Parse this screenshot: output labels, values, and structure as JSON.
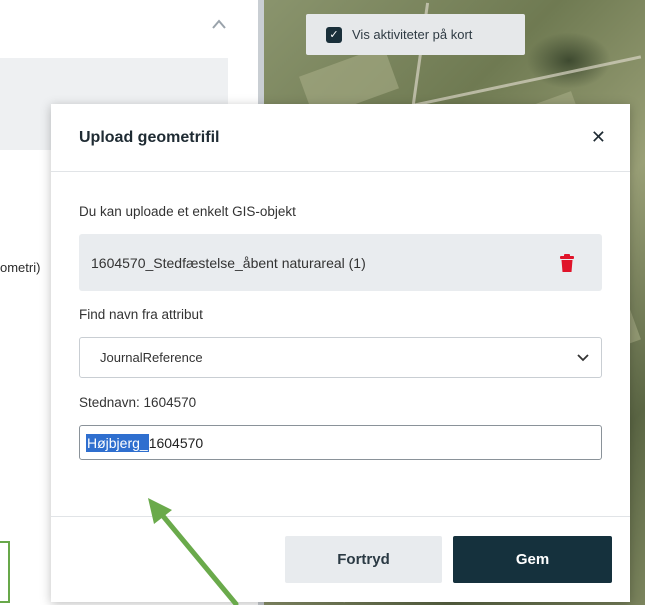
{
  "left_panel": {
    "cut_text": "ometri)"
  },
  "map": {
    "toggle_label": "Vis aktiviteter på kort",
    "checked_glyph": "✓"
  },
  "modal": {
    "title": "Upload geometrifil",
    "close_glyph": "✕",
    "help_text": "Du kan uploade et enkelt GIS-objekt",
    "file_name": "1604570_Stedfæstelse_åbent naturareal (1)",
    "attribute_label": "Find navn fra attribut",
    "attribute_select_value": "JournalReference",
    "stednavn_text": "Stednavn: 1604570",
    "name_input": {
      "selected_part": "Højbjerg_",
      "rest": "1604570"
    },
    "cancel_label": "Fortryd",
    "save_label": "Gem"
  },
  "colors": {
    "primary_button": "#15313d",
    "trash_icon": "#e0142a",
    "annotation_arrow": "#6aaa4b",
    "text_selection": "#2f6fcf"
  },
  "icons": [
    "chevron-up-icon",
    "checkbox-checked-icon",
    "close-icon",
    "trash-icon",
    "chevron-down-icon",
    "annotation-arrow"
  ]
}
